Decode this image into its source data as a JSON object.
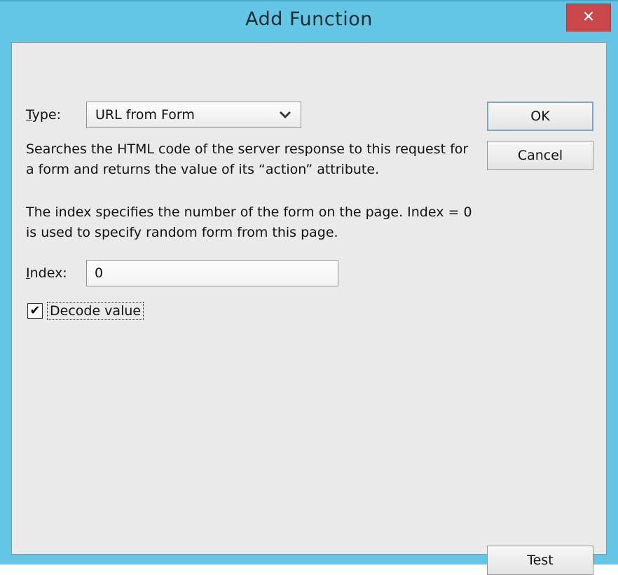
{
  "window": {
    "title": "Add Function",
    "frame_color": "#62c6e4",
    "client_bg": "#eaeaea",
    "close_button": {
      "icon": "close-icon",
      "glyph": "✕",
      "color": "#c9474a"
    }
  },
  "form": {
    "type": {
      "label": "Type:",
      "accel": "T",
      "label_rest": "ype:",
      "value": "URL from Form",
      "arrow_icon": "chevron-down-icon",
      "arrow_glyph": "⌄"
    },
    "description": {
      "paragraph_1": "Searches the HTML code of the server response to this request for a form and returns the value of its “action” attribute.",
      "paragraph_2": "The index specifies the number of the form on the page. Index = 0 is used to specify random form from this page."
    },
    "index": {
      "label": "Index:",
      "accel": "I",
      "label_rest": "ndex:",
      "value": "0",
      "placeholder": ""
    },
    "decode": {
      "label": "Decode value",
      "checked": true,
      "check_glyph": "✔"
    }
  },
  "buttons": {
    "ok": "OK",
    "cancel": "Cancel",
    "test": "Test"
  }
}
